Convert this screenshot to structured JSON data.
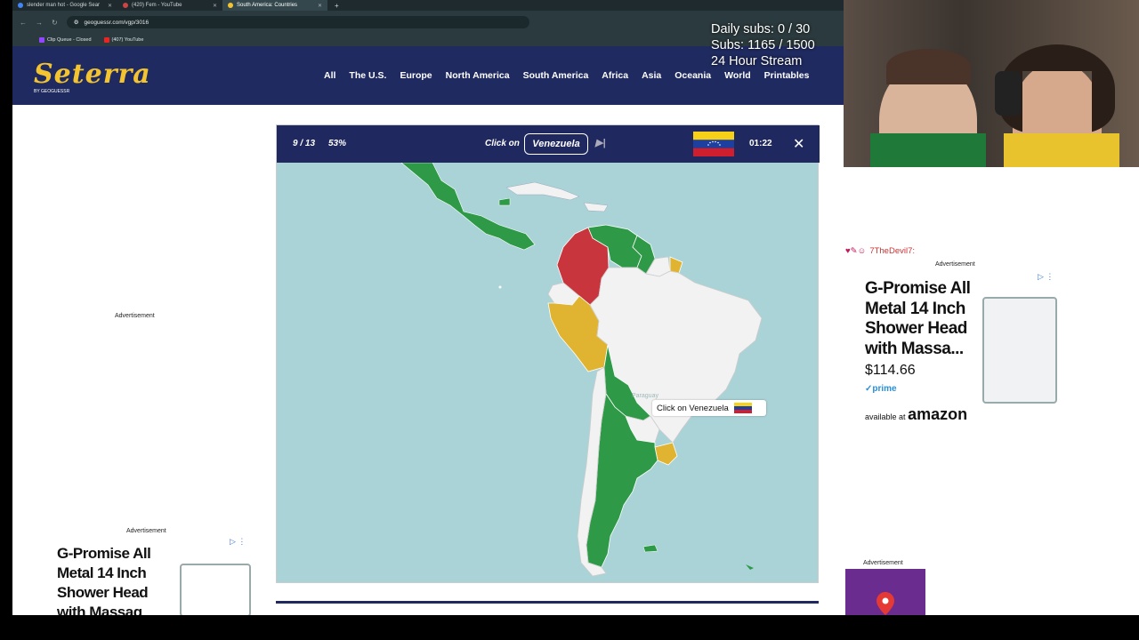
{
  "browser": {
    "tabs": [
      {
        "label": "slender man hot - Google Sear"
      },
      {
        "label": "(420) Fem - YouTube"
      },
      {
        "label": "South America: Countries"
      }
    ],
    "url": "geoguessr.com/vgp/3016",
    "bookmarks": [
      {
        "label": "Clip Queue - Closed"
      },
      {
        "label": "(407) YouTube"
      }
    ]
  },
  "site": {
    "logo": "Seterra",
    "logo_sub": "BY GEOGUESSR",
    "nav": [
      "All",
      "The U.S.",
      "Europe",
      "North America",
      "South America",
      "Africa",
      "Asia",
      "Oceania",
      "World",
      "Printables"
    ]
  },
  "overlay": {
    "line1": "Daily subs: 0 / 30",
    "line2": "Subs: 1165 / 1500",
    "line3": "24 Hour Stream"
  },
  "game": {
    "progress": "9 / 13",
    "percent": "53%",
    "prompt": "Click on",
    "target": "Venezuela",
    "timer": "01:22",
    "tooltip": "Click on Venezuela",
    "ghost_label": "Paraguay",
    "colors": {
      "correct": "#2e9a47",
      "wrong": "#c9353c",
      "partial": "#e0b431",
      "unanswered": "#f2f2f2",
      "sea": "#aad3d7"
    }
  },
  "ads": {
    "label": "Advertisement",
    "right": {
      "title": "G-Promise All Metal 14 Inch Shower Head with Massa...",
      "price": "$114.66",
      "prime": "prime",
      "available": "available at",
      "store": "amazon"
    },
    "left": {
      "title": "G-Promise All Metal 14 Inch Shower Head with Massag"
    }
  },
  "chat": {
    "user": "7TheDevil7:"
  }
}
